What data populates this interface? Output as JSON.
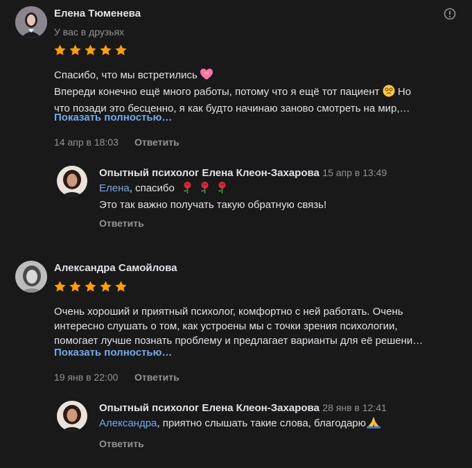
{
  "reviews": [
    {
      "author": "Елена Тюменева",
      "status": "У вас в друзьях",
      "rating": 5,
      "text_line1": "Спасибо, что мы встретились",
      "text_line2": "Впереди конечно ещё много работы, потому что я ещё тот пациент",
      "text_line2_end": "Но",
      "text_line3": "что позади это бесценно, я как будто начинаю заново смотреть на мир,…",
      "show_more": "Показать полностью…",
      "date": "14 апр в 18:03",
      "reply_label": "Ответить",
      "reply": {
        "author": "Опытный психолог Елена Клеон-Захарова",
        "date": "15 апр в 13:49",
        "mention": "Елена",
        "line1_rest": ", спасибо",
        "line2": "Это так важно получать такую обратную связь!",
        "reply_label": "Ответить"
      }
    },
    {
      "author": "Александра Самойлова",
      "rating": 5,
      "text_line1": "Очень хороший и приятный психолог, комфортно с ней работать. Очень",
      "text_line2": "интересно слушать о том, как устроены мы с точки зрения психологии,",
      "text_line3": "помогает лучше познать проблему и предлагает варианты для её решени…",
      "show_more": "Показать полностью…",
      "date": "19 янв в 22:00",
      "reply_label": "Ответить",
      "reply": {
        "author": "Опытный психолог Елена Клеон-Захарова",
        "date": "28 янв в 12:41",
        "mention": "Александра",
        "line1_rest": ", приятно слышать такие слова, благодарю",
        "reply_label": "Ответить"
      }
    }
  ],
  "icons": {
    "report": "exclamation-circle-icon",
    "star": "star-icon",
    "rose": "rose-icon",
    "heart": "heart-icon",
    "dizzy_face": "dizzy-face-icon",
    "pray": "pray-icon"
  },
  "colors": {
    "background": "#191919",
    "text": "#e1e3e6",
    "secondary": "#939393",
    "link": "#71aaeb",
    "star": "#ffa000"
  }
}
